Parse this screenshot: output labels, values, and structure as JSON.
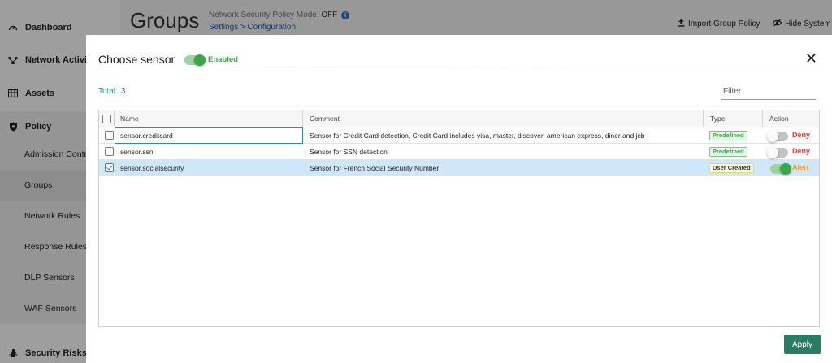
{
  "sidebar": {
    "items": [
      {
        "label": "Dashboard",
        "icon": "gauge-icon"
      },
      {
        "label": "Network Activity",
        "icon": "network-icon"
      },
      {
        "label": "Assets",
        "icon": "assets-icon"
      },
      {
        "label": "Policy",
        "icon": "shield-icon"
      },
      {
        "label": "Admission Control"
      },
      {
        "label": "Groups"
      },
      {
        "label": "Network Rules"
      },
      {
        "label": "Response Rules"
      },
      {
        "label": "DLP Sensors"
      },
      {
        "label": "WAF Sensors"
      },
      {
        "label": "Security Risks",
        "icon": "bug-icon"
      }
    ]
  },
  "header": {
    "title": "Groups",
    "mode_label": "Network Security Policy Mode:",
    "mode_value": "OFF",
    "breadcrumb": "Settings > Configuration",
    "import_label": "Import Group Policy",
    "hide_label": "Hide System G"
  },
  "modal": {
    "title": "Choose sensor",
    "toggle_label": "Enabled",
    "toggle_on": true,
    "total_label": "Total:",
    "total_count": "3",
    "filter_placeholder": "Filter",
    "columns": {
      "name": "Name",
      "comment": "Comment",
      "type": "Type",
      "action": "Action"
    },
    "rows": [
      {
        "name": "sensor.creditcard",
        "comment": "Sensor for Credit Card detection, Credit Card includes visa, master, discover, american express, diner and jcb",
        "type": "Predefined",
        "action": "Deny",
        "checked": false,
        "toggle_on": false
      },
      {
        "name": "sensor.ssn",
        "comment": "Sensor for SSN detection",
        "type": "Predefined",
        "action": "Deny",
        "checked": false,
        "toggle_on": false
      },
      {
        "name": "sensor.socialsecurity",
        "comment": "Sensor for French Social Security Number",
        "type": "User Created",
        "action": "Alert",
        "checked": true,
        "toggle_on": true
      }
    ],
    "apply_label": "Apply"
  },
  "colors": {
    "accent": "#2a7d62",
    "link": "#2d83c5",
    "deny": "#e53935",
    "alert": "#f39c33",
    "enabled": "#3aa84a"
  }
}
